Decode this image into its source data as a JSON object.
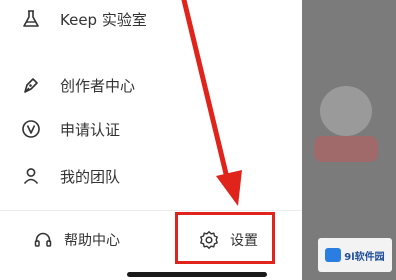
{
  "menu": {
    "items": [
      {
        "label": "Keep 实验室",
        "icon": "flask-icon"
      },
      {
        "label": "创作者中心",
        "icon": "pen-icon"
      },
      {
        "label": "申请认证",
        "icon": "verified-v-icon"
      },
      {
        "label": "我的团队",
        "icon": "person-icon"
      }
    ]
  },
  "bottom_bar": {
    "help_label": "帮助中心",
    "help_icon": "headphones-icon",
    "settings_label": "设置",
    "settings_icon": "gear-icon"
  },
  "annotation": {
    "color": "#e0241b"
  },
  "watermark": {
    "text": "9l软件园"
  }
}
